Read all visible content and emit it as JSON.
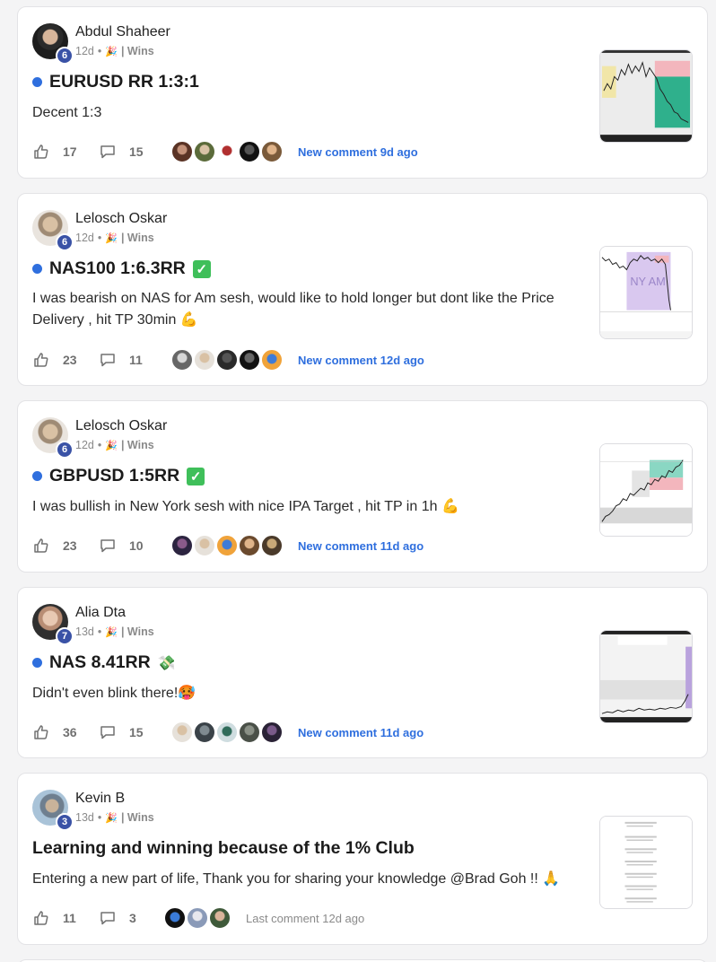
{
  "posts": [
    {
      "author": "Abdul Shaheer",
      "level": "6",
      "time": "12d",
      "separator": "•",
      "category": "| Wins",
      "title": "EURUSD RR 1:3:1",
      "body": "Decent 1:3",
      "likes": "17",
      "comments": "15",
      "comment_status": "New comment 9d ago"
    },
    {
      "author": "Lelosch Oskar",
      "level": "6",
      "time": "12d",
      "separator": "•",
      "category": "| Wins",
      "title": "NAS100 1:6.3RR",
      "title_emoji": "✓",
      "body": "I was bearish on NAS for Am sesh, would like to hold longer but dont like the Price Delivery , hit TP 30min 💪",
      "likes": "23",
      "comments": "11",
      "comment_status": "New comment 12d ago",
      "thumb_label": "NY AM"
    },
    {
      "author": "Lelosch Oskar",
      "level": "6",
      "time": "12d",
      "separator": "•",
      "category": "| Wins",
      "title": "GBPUSD 1:5RR",
      "title_emoji": "✓",
      "body": "I was bullish in New York sesh with nice IPA Target , hit TP in 1h 💪",
      "likes": "23",
      "comments": "10",
      "comment_status": "New comment 11d ago"
    },
    {
      "author": "Alia Dta",
      "level": "7",
      "time": "13d",
      "separator": "•",
      "category": "| Wins",
      "title": "NAS 8.41RR",
      "title_emoji": "💸",
      "body": "Didn't even blink there!🥵",
      "likes": "36",
      "comments": "15",
      "comment_status": "New comment 11d ago"
    },
    {
      "author": "Kevin B",
      "level": "3",
      "time": "13d",
      "separator": "•",
      "category": "| Wins",
      "title": "Learning and winning because of the 1% Club",
      "body": "Entering a new part of life, Thank you for sharing your knowledge @Brad Goh !! 🙏",
      "likes": "11",
      "comments": "3",
      "comment_status": "Last comment 12d ago"
    }
  ],
  "icons": {
    "like": "thumbs-up-icon",
    "comment": "comment-bubble-icon",
    "pinned": "blue-dot-icon",
    "category": "party-popper-icon"
  },
  "colors": {
    "accent": "#2f6fde",
    "level_badge": "#3a52a6",
    "check": "#3fbf5a"
  }
}
